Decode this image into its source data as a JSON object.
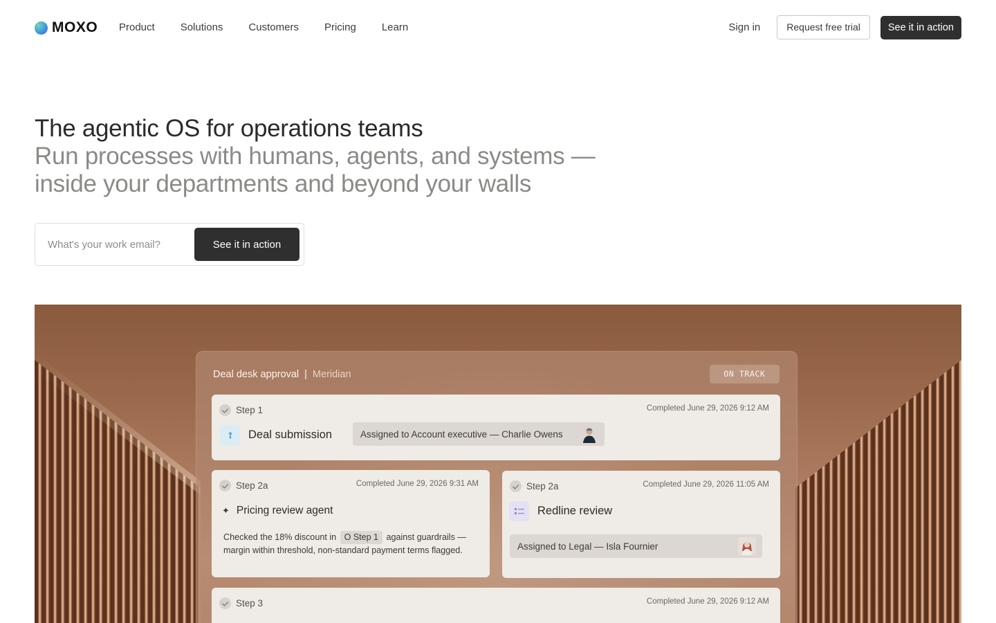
{
  "brand": {
    "name": "MOXO"
  },
  "nav": {
    "links": [
      "Product",
      "Solutions",
      "Customers",
      "Pricing",
      "Learn"
    ],
    "signin": "Sign in",
    "trial": "Request free trial",
    "cta": "See it in action"
  },
  "hero": {
    "title": "The agentic OS for operations teams",
    "subtitle": "Run processes with humans, agents, and systems — inside your departments and beyond your walls",
    "email_placeholder": "What's your work email?",
    "cta": "See it in action"
  },
  "workflow": {
    "title": "Deal desk approval",
    "separator": "|",
    "client": "Meridian",
    "status": "ON TRACK",
    "steps": [
      {
        "step": "Step 1",
        "completed": "Completed June 29, 2026  9:12 AM",
        "task": "Deal submission",
        "icon": "person-icon",
        "assignee": "Assigned to Account executive — Charlie Owens"
      },
      {
        "step": "Step 2a",
        "completed": "Completed June 29, 2026  9:31 AM",
        "task": "Pricing review agent",
        "icon": "sparkle-icon",
        "note_before": "Checked the 18% discount in",
        "note_ref": "O Step 1",
        "note_after": "against guardrails — margin within threshold, non-standard payment terms flagged."
      },
      {
        "step": "Step 2a",
        "completed": "Completed June 29, 2026  11:05 AM",
        "task": "Redline review",
        "icon": "list-icon",
        "assignee": "Assigned to Legal — Isla Fournier"
      },
      {
        "step": "Step 3",
        "completed": "Completed June 29, 2026  9:12 AM"
      }
    ]
  }
}
